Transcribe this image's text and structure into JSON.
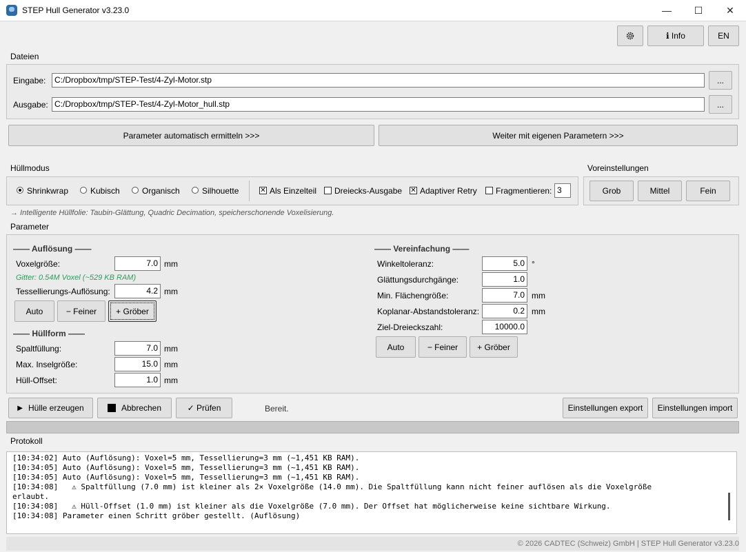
{
  "window": {
    "title": "STEP Hull Generator v3.23.0",
    "minimize": "—",
    "maximize": "☐",
    "close": "✕"
  },
  "toolbar": {
    "settings_icon": "gear-icon",
    "info_label": "ℹ Info",
    "lang_label": "EN"
  },
  "files": {
    "section": "Dateien",
    "input_label": "Eingabe:",
    "input_value": "C:/Dropbox/tmp/STEP-Test/4-Zyl-Motor.stp",
    "output_label": "Ausgabe:",
    "output_value": "C:/Dropbox/tmp/STEP-Test/4-Zyl-Motor_hull.stp",
    "browse_label": "..."
  },
  "actions": {
    "auto_params": "Parameter automatisch ermitteln  >>>",
    "own_params": "Weiter mit eigenen Parametern  >>>"
  },
  "hull_mode": {
    "section": "Hüllmodus",
    "options": [
      "Shrinkwrap",
      "Kubisch",
      "Organisch",
      "Silhouette"
    ],
    "selected": "Shrinkwrap",
    "as_single": "Als Einzelteil",
    "as_single_checked": true,
    "triangle_output": "Dreiecks-Ausgabe",
    "triangle_output_checked": false,
    "adaptive_retry": "Adaptiver Retry",
    "adaptive_retry_checked": true,
    "fragment": "Fragmentieren:",
    "fragment_checked": false,
    "fragment_value": "3",
    "hint": "→ Intelligente Hüllfolie: Taubin-Glättung, Quadric Decimation, speicherschonende Voxelisierung."
  },
  "presets": {
    "section": "Voreinstellungen",
    "coarse": "Grob",
    "medium": "Mittel",
    "fine": "Fein"
  },
  "params": {
    "section": "Parameter",
    "resolution": {
      "title": "—— Auflösung ——",
      "voxel_label": "Voxelgröße:",
      "voxel_value": "7.0",
      "voxel_unit": "mm",
      "grid_info": "Gitter: 0.54M Voxel  (~529 KB RAM)",
      "tess_label": "Tessellierungs-Auflösung:",
      "tess_value": "4.2",
      "tess_unit": "mm",
      "auto": "Auto",
      "finer": "− Feiner",
      "coarser": "+ Gröber"
    },
    "hullform": {
      "title": "—— Hüllform ——",
      "gap_label": "Spaltfüllung:",
      "gap_value": "7.0",
      "gap_unit": "mm",
      "island_label": "Max. Inselgröße:",
      "island_value": "15.0",
      "island_unit": "mm",
      "offset_label": "Hüll-Offset:",
      "offset_value": "1.0",
      "offset_unit": "mm"
    },
    "simplify": {
      "title": "—— Vereinfachung ——",
      "angle_label": "Winkeltoleranz:",
      "angle_value": "5.0",
      "angle_unit": "°",
      "smooth_label": "Glättungsdurchgänge:",
      "smooth_value": "1.0",
      "minface_label": "Min. Flächengröße:",
      "minface_value": "7.0",
      "minface_unit": "mm",
      "coplanar_label": "Koplanar-Abstandstoleranz:",
      "coplanar_value": "0.2",
      "coplanar_unit": "mm",
      "target_label": "Ziel-Dreieckszahl:",
      "target_value": "10000.0",
      "auto": "Auto",
      "finer": "− Feiner",
      "coarser": "+ Gröber"
    }
  },
  "bottom": {
    "generate": "Hülle erzeugen",
    "cancel": "Abbrechen",
    "check": "✓  Prüfen",
    "status": "Bereit.",
    "export": "Einstellungen export",
    "import": "Einstellungen import"
  },
  "log": {
    "section": "Protokoll",
    "lines": [
      "[10:34:02] Auto (Auflösung): Voxel=5 mm, Tessellierung=3 mm (~1,451 KB RAM).",
      "[10:34:05] Auto (Auflösung): Voxel=5 mm, Tessellierung=3 mm (~1,451 KB RAM).",
      "[10:34:05] Auto (Auflösung): Voxel=5 mm, Tessellierung=3 mm (~1,451 KB RAM).",
      "[10:34:08]   ⚠ Spaltfüllung (7.0 mm) ist kleiner als 2× Voxelgröße (14.0 mm). Die Spaltfüllung kann nicht feiner auflösen als die Voxelgröße",
      "erlaubt.",
      "[10:34:08]   ⚠ Hüll-Offset (1.0 mm) ist kleiner als die Voxelgröße (7.0 mm). Der Offset hat möglicherweise keine sichtbare Wirkung.",
      "[10:34:08] Parameter einen Schritt gröber gestellt. (Auflösung)"
    ]
  },
  "footer": "© 2026 CADTEC (Schweiz) GmbH  |  STEP Hull Generator v3.23.0"
}
